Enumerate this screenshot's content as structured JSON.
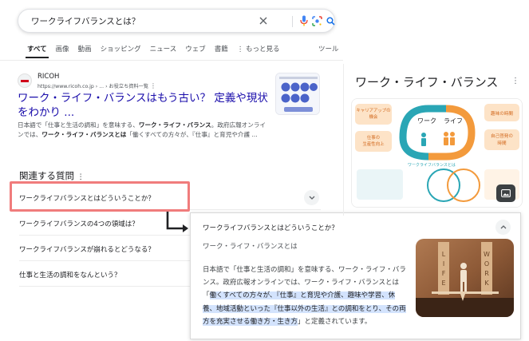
{
  "search": {
    "query": "ワークライフバランスとは？"
  },
  "tabs": {
    "items": [
      "すべて",
      "画像",
      "動画",
      "ショッピング",
      "ニュース",
      "ウェブ",
      "書籍",
      "もっと見る"
    ],
    "tools_label": "ツール"
  },
  "result": {
    "site_name": "RICOH",
    "url": "https://www.ricoh.co.jp › ... › お役立ち資料一覧",
    "title": "ワーク・ライフ・バランスはもう古い？ 定義や現状をわかり ...",
    "snippet_1": "日本語で「仕事と生活の調和」を意味する、",
    "snippet_bold_1": "ワーク・ライフ・バランス",
    "snippet_2": "。政府広報オンラインでは、",
    "snippet_bold_2": "ワーク・ライフ・バランスとは",
    "snippet_3": "「働くすべての方々が、『仕事』と育児や介護 ..."
  },
  "paa": {
    "heading": "関連する質問",
    "questions": [
      "ワークライフバランスとはどういうことか？",
      "ワークライフバランスの4つの領域は？",
      "ワークライフバランスが崩れるとどうなる？",
      "仕事と生活の調和をなんという？"
    ]
  },
  "popup": {
    "question": "ワークライフバランスとはどういうことか？",
    "subtitle": "ワーク・ライフ・バランスとは",
    "text_plain": "日本語で「仕事と生活の調和」を意味する、ワーク・ライフ・バランス。政府広報オンラインでは、ワーク・ライフ・バランスとは「",
    "text_highlight": "働くすべての方々が、『仕事』と育児や介護、趣味や学習、休養、地域活動といった『仕事以外の生活』との調和をとり、その両方を充実させる働き方・生き方",
    "text_end": "」と定義されています。",
    "image_words": [
      "LIFE",
      "WORK"
    ]
  },
  "knowledge_panel": {
    "title": "ワーク・ライフ・バランス",
    "image_labels": {
      "left_top": "キャリアアップの機会",
      "left_bottom": "仕事の生産性向上",
      "center_work": "ワーク",
      "center_life": "ライフ",
      "right_top": "趣味の時間",
      "right_bottom": "自己啓発の時間",
      "lower_title": "ワークライフバランスとは"
    }
  },
  "colors": {
    "link": "#1a0dab",
    "highlight_box": "#f07c7c",
    "text_highlight": "#d3e3fd",
    "kp_orange": "#f39a3c",
    "kp_teal": "#2aa6b5"
  }
}
